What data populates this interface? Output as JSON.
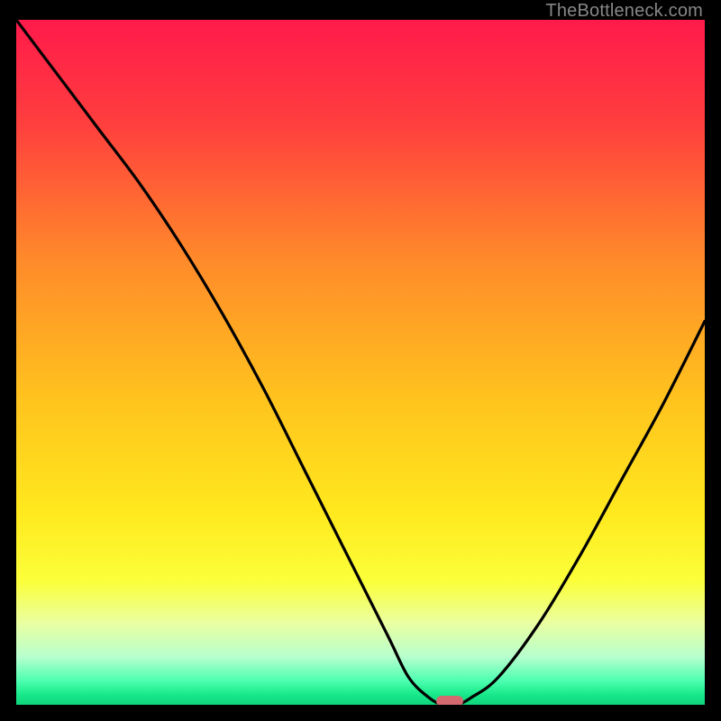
{
  "watermark": {
    "text": "TheBottleneck.com"
  },
  "chart_data": {
    "type": "line",
    "title": "",
    "xlabel": "",
    "ylabel": "",
    "xlim": [
      0,
      100
    ],
    "ylim": [
      0,
      100
    ],
    "grid": false,
    "legend": false,
    "x": [
      0,
      6,
      12,
      18,
      24,
      30,
      36,
      42,
      48,
      54,
      57,
      60,
      62,
      64,
      66,
      70,
      76,
      82,
      88,
      94,
      100
    ],
    "y": [
      100,
      92,
      84,
      76,
      67,
      57,
      46,
      34,
      22,
      10,
      4,
      1,
      0,
      0,
      1,
      4,
      12,
      22,
      33,
      44,
      56
    ],
    "series_name": "bottleneck-curve",
    "marker": {
      "x": 63,
      "y": 0,
      "color": "#d46a6f",
      "label": "optimal-point"
    },
    "background_gradient": {
      "stops": [
        {
          "offset": 0.0,
          "color": "#ff1a4b"
        },
        {
          "offset": 0.15,
          "color": "#ff3e3e"
        },
        {
          "offset": 0.35,
          "color": "#ff8a2a"
        },
        {
          "offset": 0.55,
          "color": "#ffc21e"
        },
        {
          "offset": 0.72,
          "color": "#ffe91e"
        },
        {
          "offset": 0.82,
          "color": "#fbff3a"
        },
        {
          "offset": 0.88,
          "color": "#eaffa0"
        },
        {
          "offset": 0.93,
          "color": "#b7ffce"
        },
        {
          "offset": 0.965,
          "color": "#4dffb0"
        },
        {
          "offset": 0.985,
          "color": "#18e989"
        },
        {
          "offset": 1.0,
          "color": "#0fd47c"
        }
      ]
    }
  }
}
